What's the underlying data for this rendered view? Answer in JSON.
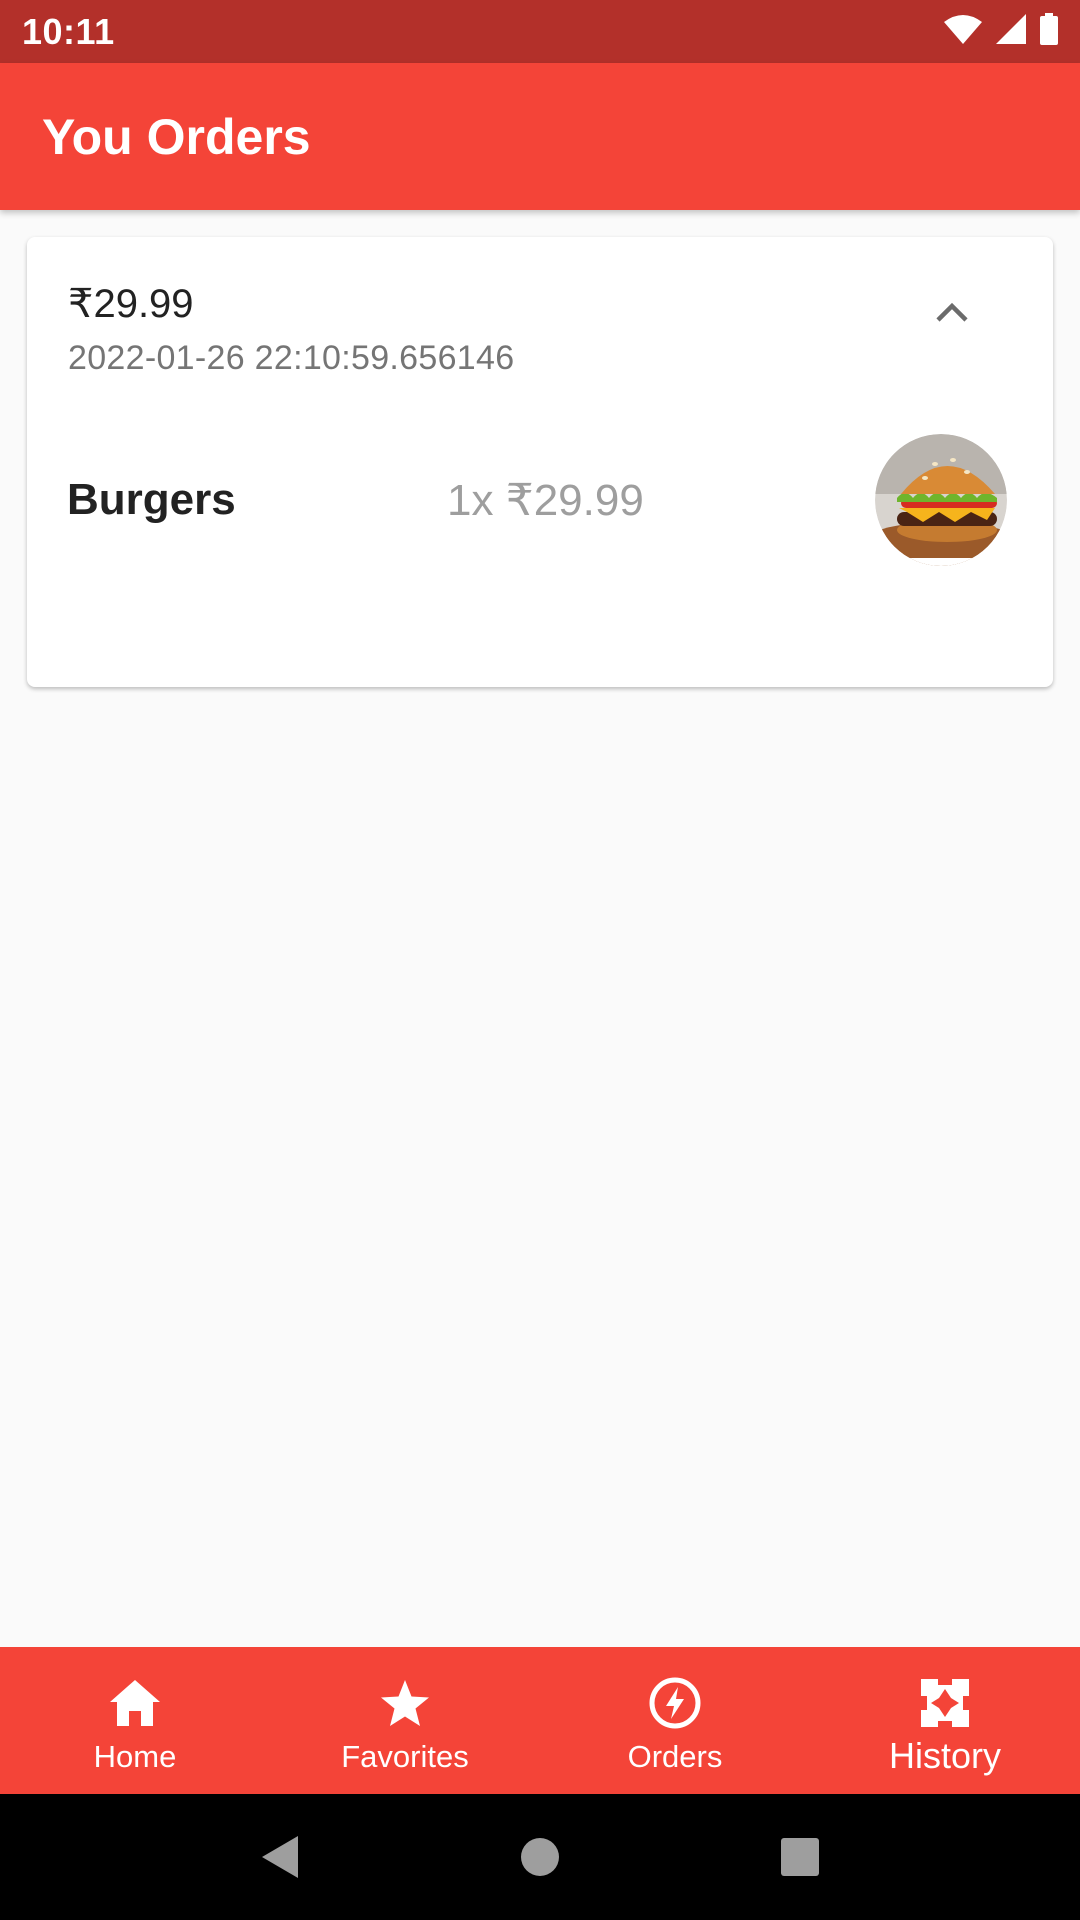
{
  "status_bar": {
    "time": "10:11",
    "icons": [
      "wifi-icon",
      "cell-signal-icon",
      "battery-icon"
    ]
  },
  "app_bar": {
    "title": "You Orders"
  },
  "orders": [
    {
      "total": "₹29.99",
      "date": "2022-01-26 22:10:59.656146",
      "expanded": true,
      "items": [
        {
          "name": "Burgers",
          "qty_price": "1x ₹29.99",
          "image": "burger-image"
        }
      ]
    }
  ],
  "bottom_nav": {
    "items": [
      {
        "label": "Home",
        "icon": "home-icon"
      },
      {
        "label": "Favorites",
        "icon": "star-icon"
      },
      {
        "label": "Orders",
        "icon": "bolt-icon"
      },
      {
        "label": "History",
        "icon": "history-icon",
        "active": true
      }
    ]
  },
  "colors": {
    "primary": "#f44438",
    "status_bar": "#b3302a",
    "background": "#fafafa"
  }
}
